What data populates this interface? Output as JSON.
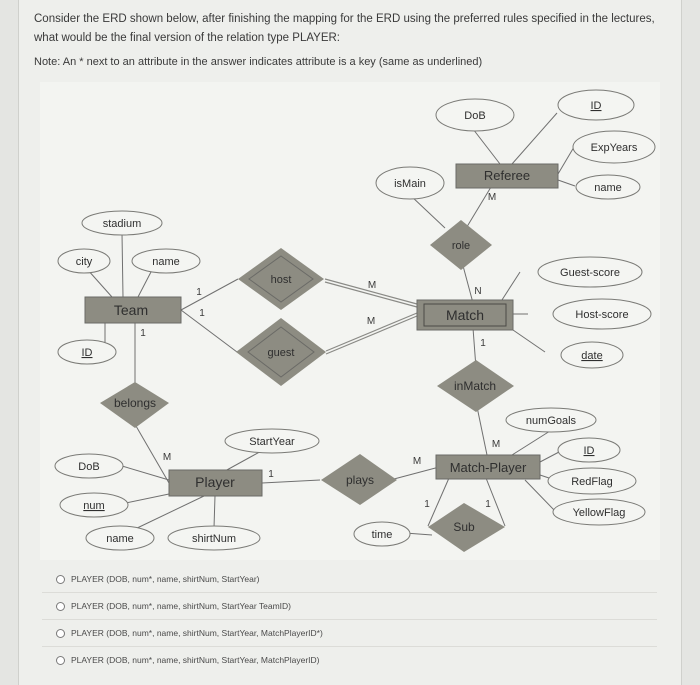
{
  "question": {
    "text": "Consider the ERD shown below, after finishing the mapping for the ERD using the preferred rules specified in the lectures, what would be the final version of the relation type PLAYER:",
    "note": "Note: An * next to an attribute in the answer indicates attribute is a key (same as underlined)"
  },
  "erd": {
    "entities": {
      "referee": "Referee",
      "team": "Team",
      "match": "Match",
      "player": "Player",
      "match_player": "Match-Player"
    },
    "relationships": {
      "role": "role",
      "host": "host",
      "guest": "guest",
      "belongs": "belongs",
      "in_match": "inMatch",
      "plays": "plays",
      "sub": "Sub"
    },
    "attributes": {
      "referee_dob": "DoB",
      "referee_id": "ID",
      "referee_expyears": "ExpYears",
      "referee_name": "name",
      "is_main": "isMain",
      "team_stadium": "stadium",
      "team_city": "city",
      "team_name": "name",
      "team_id": "ID",
      "guest_score": "Guest-score",
      "host_score": "Host-score",
      "match_date": "date",
      "num_goals": "numGoals",
      "mp_id": "ID",
      "red_flag": "RedFlag",
      "yellow_flag": "YellowFlag",
      "player_dob": "DoB",
      "player_num": "num",
      "player_name": "name",
      "shirt_num": "shirtNum",
      "start_year": "StartYear",
      "sub_time": "time"
    },
    "cardinalities": {
      "referee_role": "M",
      "role_match": "N",
      "team_host": "1",
      "team_guest": "1",
      "host_match": "M",
      "guest_match": "M",
      "team_belongs": "1",
      "belongs_player": "M",
      "match_inmatch": "1",
      "inmatch_mp": "M",
      "player_plays": "1",
      "plays_mp": "M",
      "sub_left": "1",
      "sub_right": "1"
    }
  },
  "options": [
    "PLAYER (DOB, num*, name, shirtNum, StartYear)",
    "PLAYER (DOB, num*, name, shirtNum, StartYear TeamID)",
    "PLAYER (DOB, num*, name, shirtNum, StartYear, MatchPlayerID*)",
    "PLAYER (DOB, num*, name, shirtNum, StartYear, MatchPlayerID)"
  ],
  "colors": {
    "shape_fill": "#8c8b80",
    "line": "#6f6f6a",
    "text": "#2f2f2f"
  }
}
